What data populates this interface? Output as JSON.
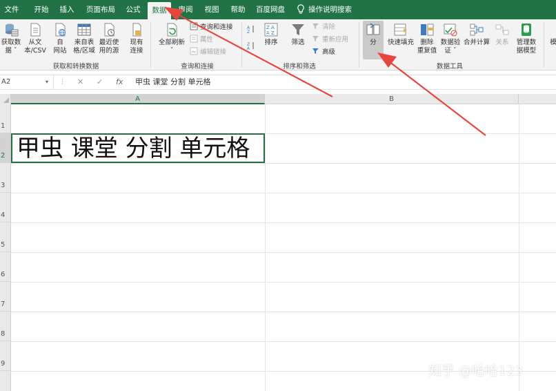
{
  "menu_tabs": [
    "文件",
    "开始",
    "插入",
    "页面布局",
    "公式",
    "数据",
    "审阅",
    "视图",
    "帮助",
    "百度网盘"
  ],
  "active_tab": "数据",
  "tell_me": "操作说明搜索",
  "ribbon": {
    "get_transform": {
      "label": "获取和转换数据",
      "buttons": [
        "获取数\n据 ˇ",
        "从文\n本/CSV",
        "自\n网站",
        "来自表\n格/区域",
        "最近使\n用的源",
        "现有\n连接"
      ]
    },
    "queries": {
      "label": "查询和连接",
      "refresh_all": "全部刷新\nˇ",
      "small": [
        "查询和连接",
        "属性",
        "编辑链接"
      ]
    },
    "sort_filter": {
      "label": "排序和筛选",
      "sort": "排序",
      "filter": "筛选",
      "small": [
        "清除",
        "重新应用",
        "高级"
      ]
    },
    "data_tools": {
      "label": "数据工具",
      "buttons": [
        "分列",
        "快速填充",
        "删除\n重复值",
        "数据验\n证 ˇ",
        "合并计算",
        "关系",
        "管理数\n据模型"
      ],
      "split_visible": "分"
    },
    "partial_next": "模"
  },
  "formula_bar": {
    "name_box": "A2",
    "caret": "▾",
    "cancel": "✕",
    "confirm": "✓",
    "fx": "fx",
    "content": "甲虫 课堂 分割 单元格"
  },
  "grid": {
    "columns": [
      "A",
      "B"
    ],
    "rows": [
      "1",
      "2",
      "3",
      "4",
      "5",
      "6",
      "7",
      "8",
      "9"
    ],
    "cell_a2": "甲虫 课堂 分割 单元格"
  },
  "watermark": "知乎 @哈哈123",
  "colors": {
    "excel_green": "#217346",
    "arrow_red": "#e8453c"
  }
}
